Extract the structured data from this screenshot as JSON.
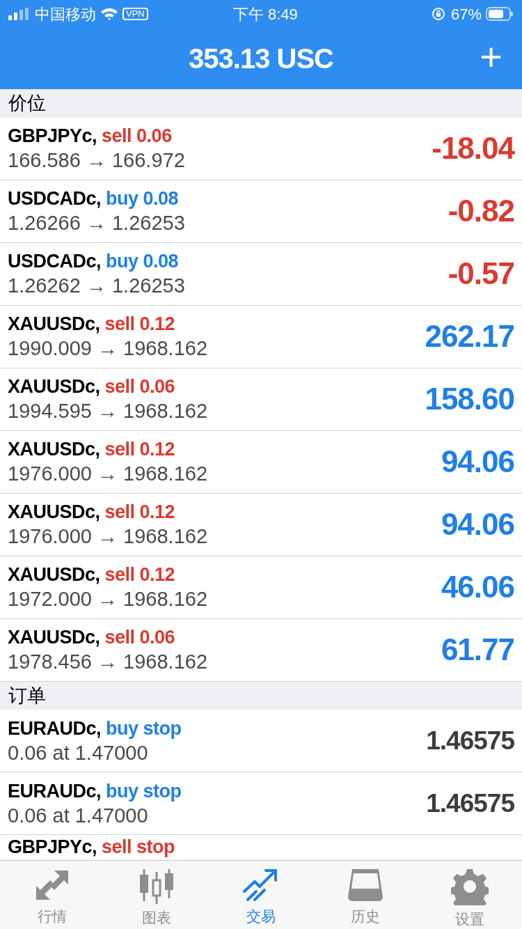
{
  "status_bar": {
    "carrier": "中国移动",
    "vpn": "VPN",
    "time": "下午 8:49",
    "battery": "67%"
  },
  "header": {
    "title": "353.13 USC",
    "action": "+"
  },
  "positions": {
    "title": "价位",
    "rows": [
      {
        "symbol": "GBPJPYc,",
        "order": {
          "text": "sell 0.06",
          "kind": "sell"
        },
        "prices": "166.586 → 166.972",
        "result": {
          "text": "-18.04",
          "kind": "loss"
        }
      },
      {
        "symbol": "USDCADc,",
        "order": {
          "text": "buy 0.08",
          "kind": "buy"
        },
        "prices": "1.26266 → 1.26253",
        "result": {
          "text": "-0.82",
          "kind": "loss"
        }
      },
      {
        "symbol": "USDCADc,",
        "order": {
          "text": "buy 0.08",
          "kind": "buy"
        },
        "prices": "1.26262 → 1.26253",
        "result": {
          "text": "-0.57",
          "kind": "loss"
        }
      },
      {
        "symbol": "XAUUSDc,",
        "order": {
          "text": "sell 0.12",
          "kind": "sell"
        },
        "prices": "1990.009 → 1968.162",
        "result": {
          "text": "262.17",
          "kind": "profit"
        }
      },
      {
        "symbol": "XAUUSDc,",
        "order": {
          "text": "sell 0.06",
          "kind": "sell"
        },
        "prices": "1994.595 → 1968.162",
        "result": {
          "text": "158.60",
          "kind": "profit"
        }
      },
      {
        "symbol": "XAUUSDc,",
        "order": {
          "text": "sell 0.12",
          "kind": "sell"
        },
        "prices": "1976.000 → 1968.162",
        "result": {
          "text": "94.06",
          "kind": "profit"
        }
      },
      {
        "symbol": "XAUUSDc,",
        "order": {
          "text": "sell 0.12",
          "kind": "sell"
        },
        "prices": "1976.000 → 1968.162",
        "result": {
          "text": "94.06",
          "kind": "profit"
        }
      },
      {
        "symbol": "XAUUSDc,",
        "order": {
          "text": "sell 0.12",
          "kind": "sell"
        },
        "prices": "1972.000 → 1968.162",
        "result": {
          "text": "46.06",
          "kind": "profit"
        }
      },
      {
        "symbol": "XAUUSDc,",
        "order": {
          "text": "sell 0.06",
          "kind": "sell"
        },
        "prices": "1978.456 → 1968.162",
        "result": {
          "text": "61.77",
          "kind": "profit"
        }
      }
    ]
  },
  "orders": {
    "title": "订单",
    "rows": [
      {
        "symbol": "EURAUDc,",
        "order": {
          "text": "buy stop",
          "kind": "buy"
        },
        "prices": "0.06 at 1.47000",
        "result": {
          "text": "1.46575",
          "kind": "pending"
        }
      },
      {
        "symbol": "EURAUDc,",
        "order": {
          "text": "buy stop",
          "kind": "buy"
        },
        "prices": "0.06 at 1.47000",
        "result": {
          "text": "1.46575",
          "kind": "pending"
        }
      },
      {
        "symbol": "GBPJPYc,",
        "order": {
          "text": "sell stop",
          "kind": "sell"
        }
      }
    ]
  },
  "tab_bar": [
    {
      "label": "行情",
      "selected": false
    },
    {
      "label": "图表",
      "selected": false
    },
    {
      "label": "交易",
      "selected": true
    },
    {
      "label": "历史",
      "selected": false
    },
    {
      "label": "设置",
      "selected": false
    }
  ]
}
